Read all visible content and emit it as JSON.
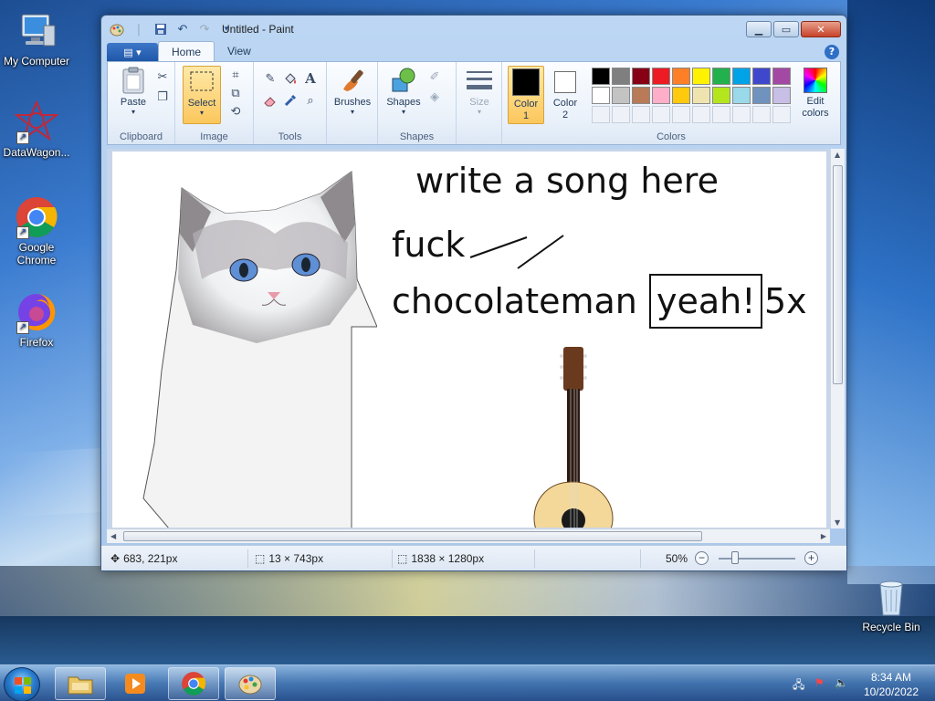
{
  "desktop": {
    "icons": [
      {
        "label": "My Computer"
      },
      {
        "label": "DataWagon..."
      },
      {
        "label": "Google Chrome"
      },
      {
        "label": "Firefox"
      },
      {
        "label": "Recycle Bin"
      }
    ]
  },
  "window": {
    "title": "Untitled - Paint",
    "tabs": [
      {
        "label": "Home",
        "active": true
      },
      {
        "label": "View",
        "active": false
      }
    ],
    "help": "?"
  },
  "ribbon": {
    "clipboard": {
      "group_label": "Clipboard",
      "paste_label": "Paste"
    },
    "image": {
      "group_label": "Image",
      "select_label": "Select"
    },
    "tools": {
      "group_label": "Tools"
    },
    "brushes": {
      "label": "Brushes"
    },
    "shapes": {
      "group_label": "Shapes",
      "shapes_label": "Shapes"
    },
    "size": {
      "label": "Size"
    },
    "colors": {
      "group_label": "Colors",
      "color1_label_line1": "Color",
      "color1_label_line2": "1",
      "color2_label_line1": "Color",
      "color2_label_line2": "2",
      "color1_value": "#000000",
      "color2_value": "#ffffff",
      "edit_label_line1": "Edit",
      "edit_label_line2": "colors",
      "palette_row1": [
        "#000000",
        "#7f7f7f",
        "#880015",
        "#ed1c24",
        "#ff7f27",
        "#fff200",
        "#22b14c",
        "#00a2e8",
        "#3f48cc",
        "#a349a4"
      ],
      "palette_row2": [
        "#ffffff",
        "#c3c3c3",
        "#b97a57",
        "#ffaec9",
        "#ffc90e",
        "#efe4b0",
        "#b5e61d",
        "#99d9ea",
        "#7092be",
        "#c8bfe7"
      ]
    }
  },
  "canvas": {
    "text_line1": "write a song here",
    "text_line2": "fuck",
    "text_line3": "chocolateman",
    "text_boxed": "yeah!",
    "text_after_box": "5x"
  },
  "status": {
    "cursor_pos": "683, 221px",
    "selection_size": "13 × 743px",
    "image_size": "1838 × 1280px",
    "zoom": "50%"
  },
  "taskbar": {
    "time": "8:34 AM",
    "date": "10/20/2022"
  }
}
